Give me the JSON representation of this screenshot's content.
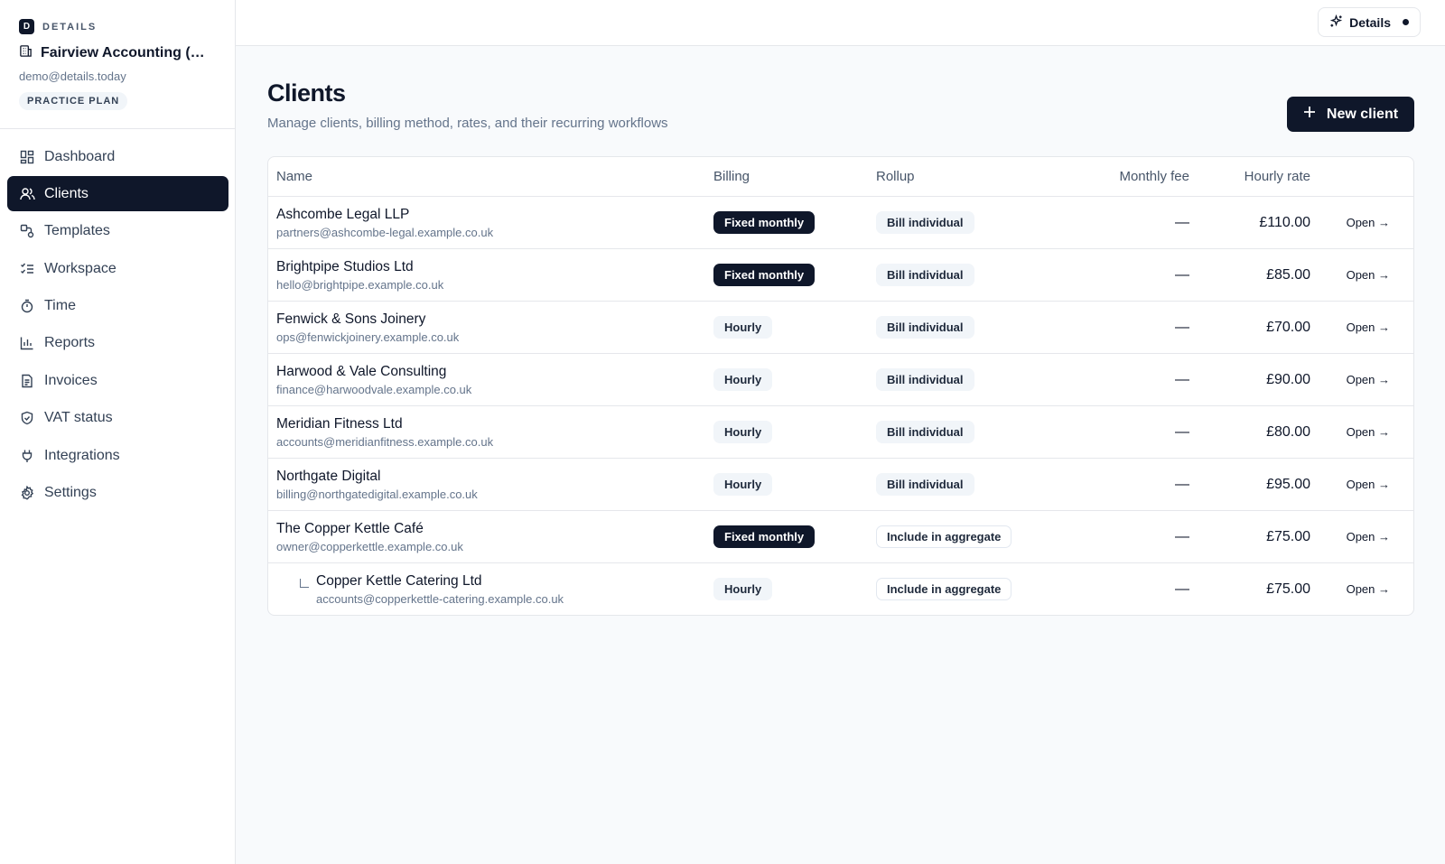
{
  "brand": {
    "mark": "D",
    "word": "DETAILS"
  },
  "org": {
    "name": "Fairview Accounting (D...",
    "email": "demo@details.today",
    "plan": "PRACTICE PLAN"
  },
  "nav": [
    {
      "label": "Dashboard",
      "icon": "dashboard-icon",
      "active": false
    },
    {
      "label": "Clients",
      "icon": "users-icon",
      "active": true
    },
    {
      "label": "Templates",
      "icon": "templates-icon",
      "active": false
    },
    {
      "label": "Workspace",
      "icon": "checklist-icon",
      "active": false
    },
    {
      "label": "Time",
      "icon": "timer-icon",
      "active": false
    },
    {
      "label": "Reports",
      "icon": "bar-chart-icon",
      "active": false
    },
    {
      "label": "Invoices",
      "icon": "document-icon",
      "active": false
    },
    {
      "label": "VAT status",
      "icon": "shield-icon",
      "active": false
    },
    {
      "label": "Integrations",
      "icon": "plug-icon",
      "active": false
    },
    {
      "label": "Settings",
      "icon": "gear-icon",
      "active": false
    }
  ],
  "topbar": {
    "details_label": "Details"
  },
  "page": {
    "title": "Clients",
    "subtitle": "Manage clients, billing method, rates, and their recurring workflows",
    "new_button": "New client"
  },
  "table": {
    "headers": {
      "name": "Name",
      "billing": "Billing",
      "rollup": "Rollup",
      "monthly_fee": "Monthly fee",
      "hourly_rate": "Hourly rate"
    },
    "rows": [
      {
        "name": "Ashcombe Legal LLP",
        "email": "partners@ashcombe-legal.example.co.uk",
        "billing": "Fixed monthly",
        "billing_style": "dark",
        "rollup": "Bill individual",
        "rollup_style": "light",
        "monthly_fee": "—",
        "hourly_rate": "£110.00",
        "open": "Open →",
        "child": false
      },
      {
        "name": "Brightpipe Studios Ltd",
        "email": "hello@brightpipe.example.co.uk",
        "billing": "Fixed monthly",
        "billing_style": "dark",
        "rollup": "Bill individual",
        "rollup_style": "light",
        "monthly_fee": "—",
        "hourly_rate": "£85.00",
        "open": "Open →",
        "child": false
      },
      {
        "name": "Fenwick & Sons Joinery",
        "email": "ops@fenwickjoinery.example.co.uk",
        "billing": "Hourly",
        "billing_style": "light",
        "rollup": "Bill individual",
        "rollup_style": "light",
        "monthly_fee": "—",
        "hourly_rate": "£70.00",
        "open": "Open →",
        "child": false
      },
      {
        "name": "Harwood & Vale Consulting",
        "email": "finance@harwoodvale.example.co.uk",
        "billing": "Hourly",
        "billing_style": "light",
        "rollup": "Bill individual",
        "rollup_style": "light",
        "monthly_fee": "—",
        "hourly_rate": "£90.00",
        "open": "Open →",
        "child": false
      },
      {
        "name": "Meridian Fitness Ltd",
        "email": "accounts@meridianfitness.example.co.uk",
        "billing": "Hourly",
        "billing_style": "light",
        "rollup": "Bill individual",
        "rollup_style": "light",
        "monthly_fee": "—",
        "hourly_rate": "£80.00",
        "open": "Open →",
        "child": false
      },
      {
        "name": "Northgate Digital",
        "email": "billing@northgatedigital.example.co.uk",
        "billing": "Hourly",
        "billing_style": "light",
        "rollup": "Bill individual",
        "rollup_style": "light",
        "monthly_fee": "—",
        "hourly_rate": "£95.00",
        "open": "Open →",
        "child": false
      },
      {
        "name": "The Copper Kettle Café",
        "email": "owner@copperkettle.example.co.uk",
        "billing": "Fixed monthly",
        "billing_style": "dark",
        "rollup": "Include in aggregate",
        "rollup_style": "outline",
        "monthly_fee": "—",
        "hourly_rate": "£75.00",
        "open": "Open →",
        "child": false
      },
      {
        "name": "Copper Kettle Catering Ltd",
        "email": "accounts@copperkettle-catering.example.co.uk",
        "billing": "Hourly",
        "billing_style": "light",
        "rollup": "Include in aggregate",
        "rollup_style": "outline",
        "monthly_fee": "—",
        "hourly_rate": "£75.00",
        "open": "Open →",
        "child": true
      }
    ]
  }
}
